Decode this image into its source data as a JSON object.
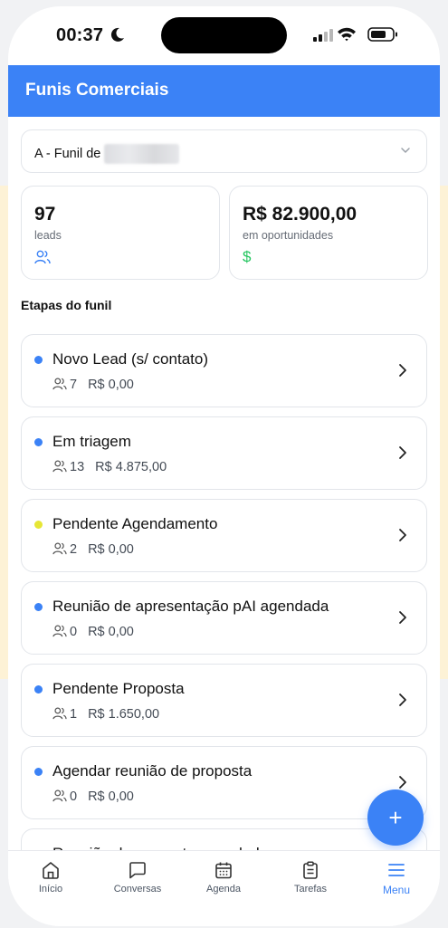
{
  "status_bar": {
    "time": "00:37"
  },
  "header": {
    "title": "Funis Comerciais"
  },
  "funnel_select": {
    "value": "A - Funil de"
  },
  "stats": {
    "leads": {
      "value": "97",
      "label": "leads"
    },
    "opportunities": {
      "value": "R$ 82.900,00",
      "label": "em oportunidades"
    }
  },
  "section_title": "Etapas do funil",
  "stages": [
    {
      "name": "Novo Lead (s/ contato)",
      "count": "7",
      "amount": "R$ 0,00",
      "color": "#3b82f6"
    },
    {
      "name": "Em triagem",
      "count": "13",
      "amount": "R$ 4.875,00",
      "color": "#3b82f6"
    },
    {
      "name": "Pendente Agendamento",
      "count": "2",
      "amount": "R$ 0,00",
      "color": "#e6e635"
    },
    {
      "name": "Reunião de apresentação pAI agendada",
      "count": "0",
      "amount": "R$ 0,00",
      "color": "#3b82f6"
    },
    {
      "name": "Pendente Proposta",
      "count": "1",
      "amount": "R$ 1.650,00",
      "color": "#3b82f6"
    },
    {
      "name": "Agendar reunião de proposta",
      "count": "0",
      "amount": "R$ 0,00",
      "color": "#3b82f6"
    },
    {
      "name": "Reunião de proposta agendada",
      "count": "",
      "amount": "",
      "color": "#3b82f6"
    }
  ],
  "fab": {
    "icon": "plus-icon",
    "label": "+"
  },
  "tabs": [
    {
      "label": "Início",
      "icon": "home-icon"
    },
    {
      "label": "Conversas",
      "icon": "chat-icon"
    },
    {
      "label": "Agenda",
      "icon": "calendar-icon"
    },
    {
      "label": "Tarefas",
      "icon": "clipboard-icon"
    },
    {
      "label": "Menu",
      "icon": "menu-icon",
      "active": true
    }
  ],
  "colors": {
    "primary": "#3b82f6",
    "success": "#22c55e"
  }
}
